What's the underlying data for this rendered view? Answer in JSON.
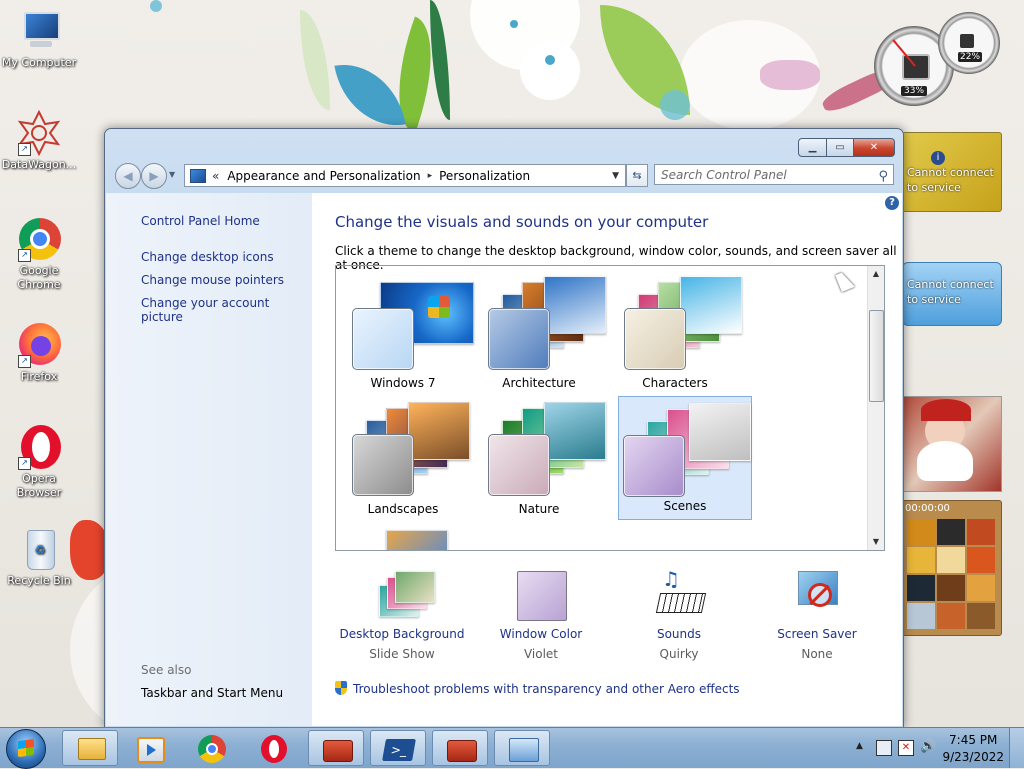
{
  "desktop": {
    "icons": [
      {
        "label": "My Computer"
      },
      {
        "label": "DataWagon..."
      },
      {
        "label": "Google Chrome"
      },
      {
        "label": "Firefox"
      },
      {
        "label": "Opera Browser"
      },
      {
        "label": "Recycle Bin"
      }
    ],
    "gadgets": {
      "cpu_percent": "33%",
      "mem_percent": "22%",
      "weather_1": "Cannot connect to service",
      "weather_2": "Cannot connect to service",
      "puzzle_time": "00:00:00"
    }
  },
  "window": {
    "breadcrumb": {
      "chevron": "«",
      "segments": [
        "Appearance and Personalization",
        "Personalization"
      ],
      "separator": "▸"
    },
    "search_placeholder": "Search Control Panel",
    "left_pane": {
      "home": "Control Panel Home",
      "links": [
        "Change desktop icons",
        "Change mouse pointers",
        "Change your account picture"
      ],
      "see_also": "See also",
      "see_also_links": [
        "Taskbar and Start Menu"
      ]
    },
    "heading": "Change the visuals and sounds on your computer",
    "description": "Click a theme to change the desktop background, window color, sounds, and screen saver all at once.",
    "themes": [
      {
        "name": "Windows 7",
        "selected": false
      },
      {
        "name": "Architecture",
        "selected": false
      },
      {
        "name": "Characters",
        "selected": false
      },
      {
        "name": "Landscapes",
        "selected": false
      },
      {
        "name": "Nature",
        "selected": false
      },
      {
        "name": "Scenes",
        "selected": true
      }
    ],
    "bottom": [
      {
        "title": "Desktop Background",
        "value": "Slide Show",
        "icon": "desktop-background-icon"
      },
      {
        "title": "Window Color",
        "value": "Violet",
        "icon": "window-color-icon"
      },
      {
        "title": "Sounds",
        "value": "Quirky",
        "icon": "sounds-icon"
      },
      {
        "title": "Screen Saver",
        "value": "None",
        "icon": "screen-saver-icon"
      }
    ],
    "troubleshoot": "Troubleshoot problems with transparency and other Aero effects"
  },
  "taskbar": {
    "time": "7:45 PM",
    "date": "9/23/2022"
  }
}
